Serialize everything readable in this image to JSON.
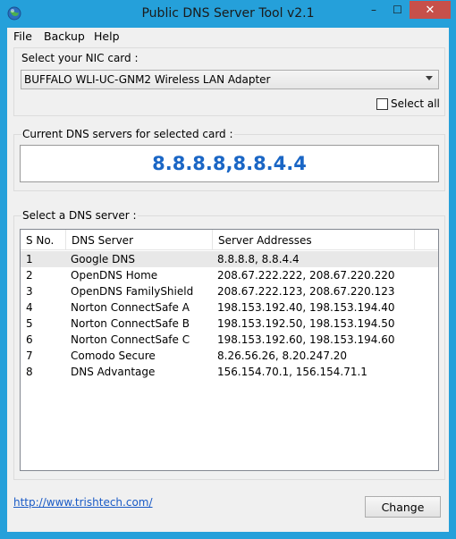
{
  "window": {
    "title": "Public DNS Server Tool v2.1"
  },
  "titlebar": {
    "minimize": "–",
    "maximize": "☐",
    "close": "✕"
  },
  "menu": {
    "items": [
      "File",
      "Backup",
      "Help"
    ]
  },
  "nic": {
    "group_label": "Select your NIC card :",
    "selected": "BUFFALO WLI-UC-GNM2 Wireless LAN Adapter",
    "select_all_label": "Select all",
    "select_all_checked": false
  },
  "current": {
    "group_label": "Current DNS servers for selected card :",
    "value": "8.8.8.8,8.8.4.4",
    "value_color": "#1a66c5"
  },
  "servers": {
    "group_label": "Select a DNS server :",
    "columns": [
      "S No.",
      "DNS Server",
      "Server Addresses"
    ],
    "rows": [
      {
        "sno": "1",
        "name": "Google DNS",
        "addresses": "8.8.8.8, 8.8.4.4",
        "selected": true
      },
      {
        "sno": "2",
        "name": "OpenDNS Home",
        "addresses": "208.67.222.222, 208.67.220.220",
        "selected": false
      },
      {
        "sno": "3",
        "name": "OpenDNS FamilyShield",
        "addresses": "208.67.222.123, 208.67.220.123",
        "selected": false
      },
      {
        "sno": "4",
        "name": "Norton ConnectSafe A",
        "addresses": "198.153.192.40, 198.153.194.40",
        "selected": false
      },
      {
        "sno": "5",
        "name": "Norton ConnectSafe B",
        "addresses": "198.153.192.50, 198.153.194.50",
        "selected": false
      },
      {
        "sno": "6",
        "name": "Norton ConnectSafe C",
        "addresses": "198.153.192.60, 198.153.194.60",
        "selected": false
      },
      {
        "sno": "7",
        "name": "Comodo Secure",
        "addresses": "8.26.56.26, 8.20.247.20",
        "selected": false
      },
      {
        "sno": "8",
        "name": "DNS Advantage",
        "addresses": "156.154.70.1, 156.154.71.1",
        "selected": false
      }
    ]
  },
  "footer": {
    "link": "http://www.trishtech.com/",
    "change_button": "Change"
  },
  "colors": {
    "titlebar": "#25a0da",
    "close_button": "#c7504a",
    "link": "#1a5bc6"
  }
}
